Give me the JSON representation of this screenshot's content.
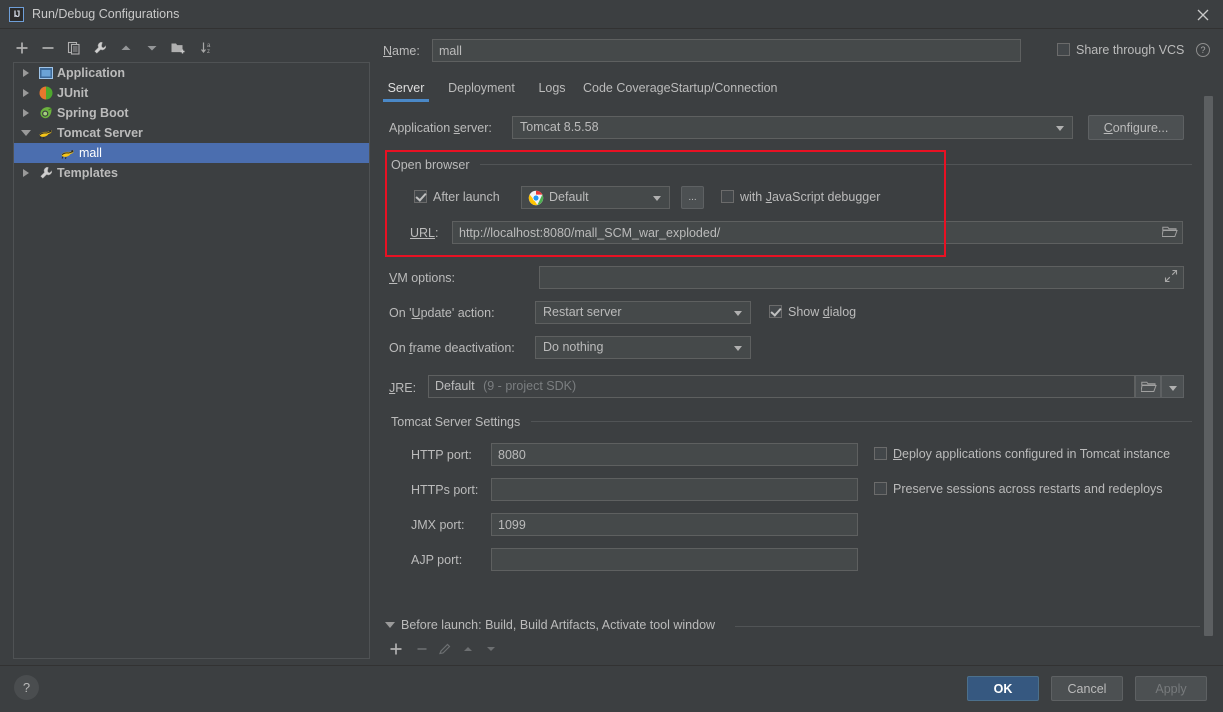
{
  "window": {
    "title": "Run/Debug Configurations",
    "logo_text": "IJ",
    "close_icon": "close-icon"
  },
  "left_toolbar": {
    "buttons": [
      {
        "name": "add-configuration-button",
        "icon": "plus-icon",
        "tooltip": "Add New Configuration"
      },
      {
        "name": "remove-configuration-button",
        "icon": "minus-icon",
        "tooltip": "Remove Configuration"
      },
      {
        "name": "copy-configuration-button",
        "icon": "copy-icon",
        "tooltip": "Copy Configuration"
      },
      {
        "name": "edit-templates-button",
        "icon": "wrench-icon",
        "tooltip": "Edit Templates"
      },
      {
        "name": "move-up-button",
        "icon": "arrow-up-icon",
        "tooltip": "Move Up"
      },
      {
        "name": "move-down-button",
        "icon": "arrow-down-icon",
        "tooltip": "Move Down"
      },
      {
        "name": "new-folder-button",
        "icon": "folder-add-icon",
        "tooltip": "Create New Folder"
      },
      {
        "name": "sort-button",
        "icon": "sort-az-icon",
        "tooltip": "Sort Configurations"
      }
    ]
  },
  "tree": {
    "items": [
      {
        "label": "Application",
        "icon": "application-icon",
        "expanded": false,
        "indent": 0,
        "selected": false,
        "group": true
      },
      {
        "label": "JUnit",
        "icon": "junit-icon",
        "expanded": false,
        "indent": 0,
        "selected": false,
        "group": true
      },
      {
        "label": "Spring Boot",
        "icon": "spring-boot-icon",
        "expanded": false,
        "indent": 0,
        "selected": false,
        "group": true
      },
      {
        "label": "Tomcat Server",
        "icon": "tomcat-icon",
        "expanded": true,
        "indent": 0,
        "selected": false,
        "group": true
      },
      {
        "label": "mall",
        "icon": "tomcat-icon",
        "expanded": null,
        "indent": 1,
        "selected": true,
        "group": false
      },
      {
        "label": "Templates",
        "icon": "wrench-icon",
        "expanded": false,
        "indent": 0,
        "selected": false,
        "group": true
      }
    ]
  },
  "header": {
    "name_label": "Name:",
    "name_value": "mall",
    "name_placeholder": "",
    "share_label": "Share through VCS",
    "share_checked": false,
    "help_icon": "question-mark-icon"
  },
  "tabs": {
    "items": [
      {
        "label": "Server",
        "active": true
      },
      {
        "label": "Deployment",
        "active": false
      },
      {
        "label": "Logs",
        "active": false
      },
      {
        "label": "Code Coverage",
        "active": false
      },
      {
        "label": "Startup/Connection",
        "active": false
      }
    ]
  },
  "server_tab": {
    "application_server": {
      "label": "Application server:",
      "value": "Tomcat 8.5.58",
      "configure_button": "Configure..."
    },
    "open_browser": {
      "group_title": "Open browser",
      "after_launch_label": "After launch",
      "after_launch_checked": true,
      "browser_value": "Default",
      "browser_icon": "chrome-icon",
      "browse_button_label": "...",
      "js_debugger_label": "with JavaScript debugger",
      "js_debugger_checked": false,
      "url_label": "URL:",
      "url_value": "http://localhost:8080/mall_SCM_war_exploded/",
      "url_folder_icon": "folder-open-icon",
      "highlight_color": "#e81123"
    },
    "vm_options": {
      "label": "VM options:",
      "value": "",
      "expand_icon": "expand-icon"
    },
    "on_update_action": {
      "label": "On 'Update' action:",
      "value": "Restart server",
      "show_dialog_label": "Show dialog",
      "show_dialog_checked": true
    },
    "on_frame_deactivation": {
      "label": "On frame deactivation:",
      "value": "Do nothing"
    },
    "jre": {
      "label": "JRE:",
      "value": "Default",
      "value_hint": "(9 - project SDK)",
      "folder_icon": "folder-open-icon",
      "dropdown_icon": "chevron-down-icon"
    },
    "tomcat_settings": {
      "group_title": "Tomcat Server Settings",
      "ports": [
        {
          "label": "HTTP port:",
          "value": "8080",
          "name": "http-port-input"
        },
        {
          "label": "HTTPs port:",
          "value": "",
          "name": "https-port-input"
        },
        {
          "label": "JMX port:",
          "value": "1099",
          "name": "jmx-port-input"
        },
        {
          "label": "AJP port:",
          "value": "",
          "name": "ajp-port-input"
        }
      ],
      "checkboxes": [
        {
          "label": "Deploy applications configured in Tomcat instance",
          "checked": false,
          "name": "deploy-applications-checkbox"
        },
        {
          "label": "Preserve sessions across restarts and redeploys",
          "checked": false,
          "name": "preserve-sessions-checkbox"
        }
      ]
    }
  },
  "before_launch": {
    "text": "Before launch: Build, Build Artifacts, Activate tool window",
    "buttons": [
      {
        "name": "before-launch-add-button",
        "icon": "plus-icon",
        "enabled": true
      },
      {
        "name": "before-launch-remove-button",
        "icon": "minus-icon",
        "enabled": false
      },
      {
        "name": "before-launch-edit-button",
        "icon": "pencil-icon",
        "enabled": false
      },
      {
        "name": "before-launch-up-button",
        "icon": "arrow-up-icon",
        "enabled": false
      },
      {
        "name": "before-launch-down-button",
        "icon": "arrow-down-icon",
        "enabled": false
      }
    ]
  },
  "footer": {
    "help_label": "?",
    "ok_label": "OK",
    "cancel_label": "Cancel",
    "apply_label": "Apply",
    "apply_enabled": false
  }
}
